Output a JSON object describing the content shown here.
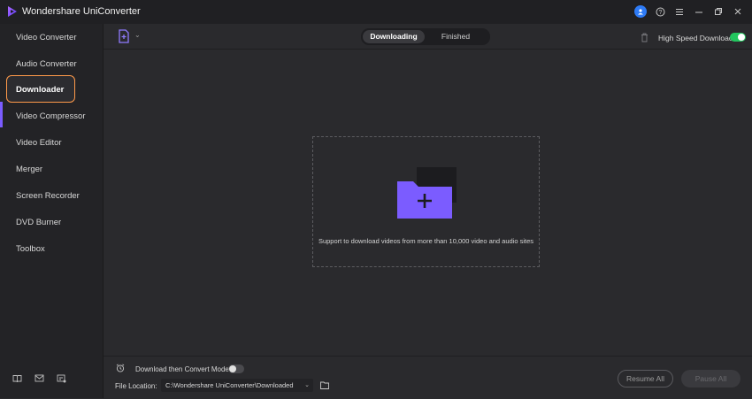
{
  "app": {
    "title": "Wondershare UniConverter"
  },
  "sidebar": {
    "items": [
      {
        "label": "Video Converter"
      },
      {
        "label": "Audio Converter"
      },
      {
        "label": "Downloader",
        "active": true
      },
      {
        "label": "Video Compressor"
      },
      {
        "label": "Video Editor"
      },
      {
        "label": "Merger"
      },
      {
        "label": "Screen Recorder"
      },
      {
        "label": "DVD Burner"
      },
      {
        "label": "Toolbox"
      }
    ],
    "bottom_icons": [
      "book-icon",
      "mail-icon",
      "feedback-icon"
    ]
  },
  "toolbar": {
    "tabs": [
      {
        "label": "Downloading",
        "active": true
      },
      {
        "label": "Finished",
        "active": false
      }
    ],
    "high_speed_label": "High Speed Download",
    "high_speed_on": true
  },
  "dropzone": {
    "text": "Support to download videos from more than 10,000 video and audio sites"
  },
  "footer": {
    "convert_mode_label": "Download then Convert Mode",
    "convert_mode_on": false,
    "file_location_label": "File Location:",
    "file_location_value": "C:\\Wondershare UniConverter\\Downloaded",
    "resume_label": "Resume All",
    "pause_label": "Pause All"
  },
  "colors": {
    "accent": "#7b5cff",
    "highlight": "#ff9a4a",
    "toggle_on": "#22c55e",
    "user": "#2e7bf6"
  }
}
